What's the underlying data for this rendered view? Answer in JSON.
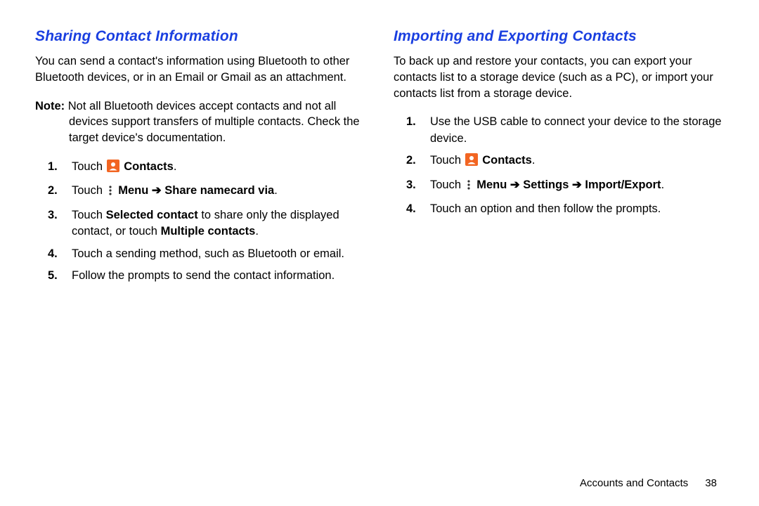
{
  "left": {
    "heading": "Sharing Contact Information",
    "intro": "You can send a contact's information using Bluetooth to other Bluetooth devices, or in an Email or Gmail as an attachment.",
    "note_label": "Note:",
    "note_text": " Not all Bluetooth devices accept contacts and not all devices support transfers of multiple contacts. Check the target device's documentation.",
    "steps": {
      "s1_num": "1.",
      "s1_a": "Touch ",
      "s1_b": " Contacts",
      "s1_c": ".",
      "s2_num": "2.",
      "s2_a": "Touch ",
      "s2_b": " Menu ",
      "s2_arrow": "➔",
      "s2_c": " Share namecard via",
      "s2_d": ".",
      "s3_num": "3.",
      "s3_a": "Touch ",
      "s3_b": "Selected contact",
      "s3_c": " to share only the displayed contact, or touch ",
      "s3_d": "Multiple contacts",
      "s3_e": ".",
      "s4_num": "4.",
      "s4_a": "Touch a sending method, such as Bluetooth or email.",
      "s5_num": "5.",
      "s5_a": "Follow the prompts to send the contact information."
    }
  },
  "right": {
    "heading": "Importing and Exporting Contacts",
    "intro": "To back up and restore your contacts, you can export your contacts list to a storage device (such as a PC), or import your contacts list from a storage device.",
    "steps": {
      "s1_num": "1.",
      "s1_a": "Use the USB cable to connect your device to the storage device.",
      "s2_num": "2.",
      "s2_a": "Touch ",
      "s2_b": " Contacts",
      "s2_c": ".",
      "s3_num": "3.",
      "s3_a": "Touch ",
      "s3_b": " Menu ",
      "s3_arrow1": "➔",
      "s3_c": " Settings ",
      "s3_arrow2": "➔",
      "s3_d": " Import/Export",
      "s3_e": ".",
      "s4_num": "4.",
      "s4_a": "Touch an option and then follow the prompts."
    }
  },
  "footer": {
    "section": "Accounts and Contacts",
    "page": "38"
  }
}
